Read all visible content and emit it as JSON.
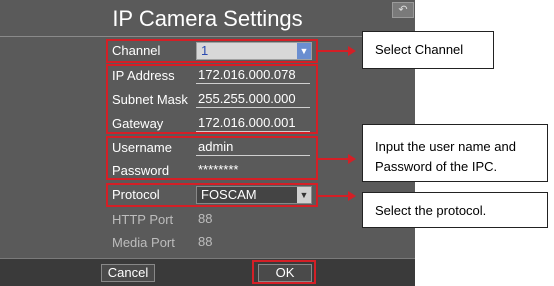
{
  "dialog": {
    "title": "IP Camera Settings",
    "back_icon": "return-arrow-icon"
  },
  "fields": {
    "channel": {
      "label": "Channel",
      "value": "1"
    },
    "ip_address": {
      "label": "IP Address",
      "value": "172.016.000.078"
    },
    "subnet_mask": {
      "label": "Subnet Mask",
      "value": "255.255.000.000"
    },
    "gateway": {
      "label": "Gateway",
      "value": "172.016.000.001"
    },
    "username": {
      "label": "Username",
      "value": "admin"
    },
    "password": {
      "label": "Password",
      "value": "********"
    },
    "protocol": {
      "label": "Protocol",
      "value": "FOSCAM"
    },
    "http_port": {
      "label": "HTTP Port",
      "value": "88"
    },
    "media_port": {
      "label": "Media Port",
      "value": "88"
    }
  },
  "buttons": {
    "cancel": "Cancel",
    "ok": "OK"
  },
  "callouts": {
    "channel": "Select Channel",
    "user_line1": "Input the user name and",
    "user_line2": "Password of the IPC.",
    "protocol": "Select the protocol."
  },
  "colors": {
    "highlight": "#d41f26",
    "dialog_bg": "#5a5a5a"
  }
}
